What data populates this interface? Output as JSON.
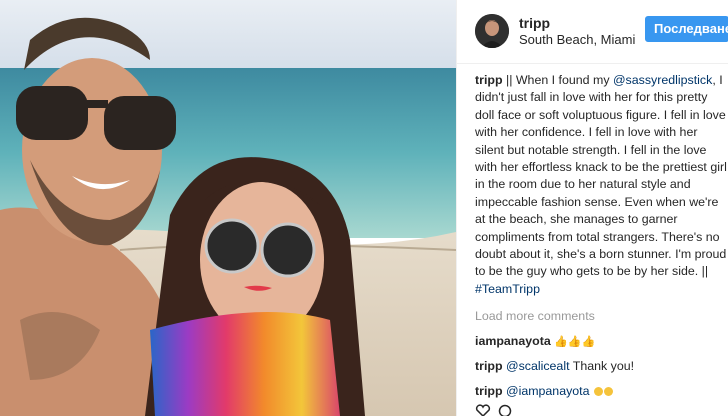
{
  "post": {
    "username": "tripp",
    "location": "South Beach, Miami",
    "follow_label": "Последване"
  },
  "caption": {
    "author": "tripp",
    "part1": "|| When I found my ",
    "mention": "@sassyredlipstick",
    "part2": ", I didn't just fall in love with her for this pretty doll face or soft voluptuous figure. I fell in love with her confidence. I fell in love with her silent but notable strength. I fell in the love with her effortless knack to be the prettiest girl in the room due to her natural style and impeccable fashion sense. Even when we're at the beach, she manages to garner compliments from total strangers. There's no doubt about it, she's a born stunner. I'm proud to be the guy who gets to be by her side. ||",
    "hashtag": "#TeamTripp"
  },
  "load_more": "Load more comments",
  "comments": [
    {
      "author": "iampanayota",
      "text": "👍👍👍"
    },
    {
      "author": "tripp",
      "mention": "@scalicealt",
      "text": " Thank you!"
    },
    {
      "author": "tripp",
      "mention": "@iampanayota",
      "text": ""
    }
  ],
  "icons": [
    "heart-icon",
    "comment-icon"
  ],
  "colors": {
    "follow_button": "#3897f0",
    "link": "#003569",
    "muted": "#999999"
  }
}
